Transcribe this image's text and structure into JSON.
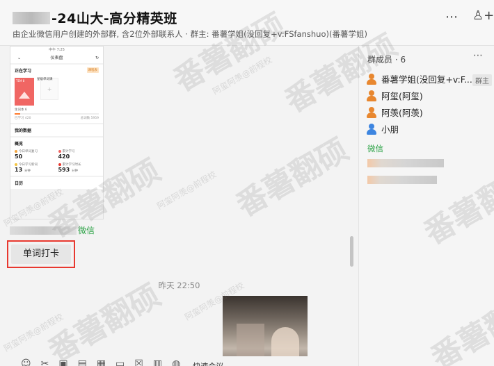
{
  "header": {
    "title": "-24山大-高分精英班",
    "subtitle": "由企业微信用户创建的外部群, 含2位外部联系人 · 群主: 番薯学姐(没回复+v:FSfanshuo)(番薯学姐)",
    "more_icon": "⋯",
    "add_member_icon": "♙+"
  },
  "phone": {
    "status": "中午 7:25",
    "nav_title": "仪表盘",
    "nav_back": "⌄",
    "nav_refresh": "↻",
    "studying_title": "正在学习",
    "studying_badge": "课程表",
    "book_caption": "TEM 8",
    "add_label": "星级单词课",
    "add_plus": "+",
    "new_words": "生词本 6",
    "learned": "已学习 420",
    "total": "总词数 5959",
    "progress": 0.07,
    "data_title": "我的数据",
    "overview": "概览",
    "today_review_label": "今日单词复习",
    "today_review_value": "50",
    "learned_label": "累计学习",
    "learned_value": "420",
    "today_learn_label": "今日学习新词",
    "today_learn_value": "13",
    "total_learn_label": "累计学习时长",
    "total_learn_value": "593",
    "unit": "分钟",
    "calendar": "日历"
  },
  "chat": {
    "sender_tag": "微信",
    "word_card_label": "单词打卡",
    "timestamp": "昨天 22:50"
  },
  "toolbar": {
    "emoji_icon": "☺",
    "scissors_icon": "✂",
    "image_icon": "▣",
    "file_icon": "▤",
    "calendar_icon": "▦",
    "folder_icon": "▭",
    "doc_icon": "☒",
    "more_icon": "▥",
    "voice_icon": "◍",
    "meeting_label": "快速会议"
  },
  "panel": {
    "title": "群成员 · 6",
    "more_icon": "⋯",
    "owner_badge": "群主",
    "members": [
      {
        "name": "番薯学姐(没回复+v:F...",
        "color": "#e8872f"
      },
      {
        "name": "阿玺(阿玺)",
        "color": "#e8872f"
      },
      {
        "name": "阿羡(阿羡)",
        "color": "#e8872f"
      },
      {
        "name": "小朋",
        "color": "#3d85e0"
      }
    ],
    "wechat_label": "微信"
  },
  "watermark": {
    "big": "番薯翻硕",
    "small": "阿玺阿羡@前程校"
  },
  "colors": {
    "accent_green": "#2ba245",
    "highlight_red": "#e8382f",
    "avatar_orange": "#e8872f",
    "avatar_blue": "#3d85e0"
  }
}
